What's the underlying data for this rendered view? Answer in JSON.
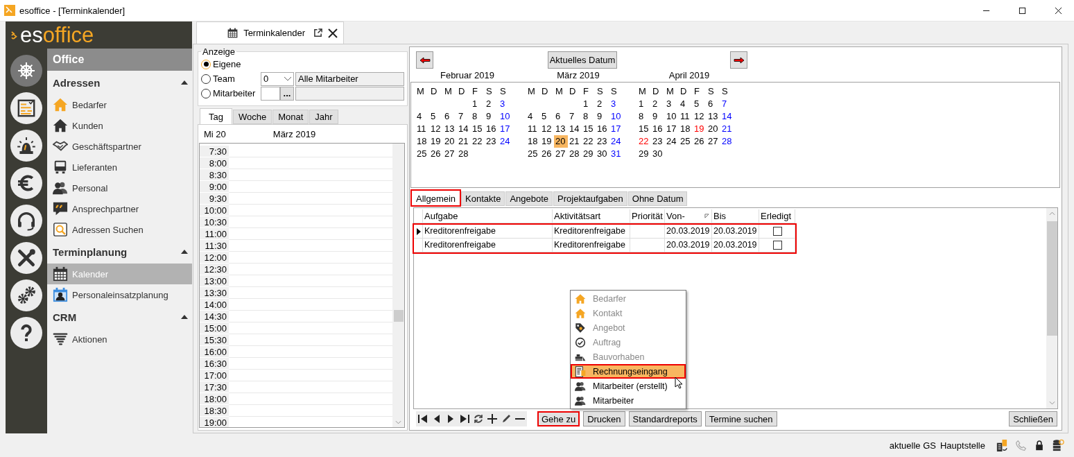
{
  "window": {
    "title": "esoffice - [Terminkalender]"
  },
  "logo": {
    "lead": "es",
    "rest": "office"
  },
  "rail": [
    {
      "selected": true
    },
    {
      "selected": false
    },
    {
      "selected": false
    },
    {
      "selected": false
    },
    {
      "selected": false
    },
    {
      "selected": false
    },
    {
      "selected": false
    },
    {
      "selected": false
    }
  ],
  "nav": {
    "header": "Office",
    "sections": [
      {
        "title": "Adressen",
        "expanded": true,
        "items": [
          {
            "label": "Bedarfer",
            "selected": false
          },
          {
            "label": "Kunden",
            "selected": false
          },
          {
            "label": "Geschäftspartner",
            "selected": false
          },
          {
            "label": "Lieferanten",
            "selected": false
          },
          {
            "label": "Personal",
            "selected": false
          },
          {
            "label": "Ansprechpartner",
            "selected": false
          },
          {
            "label": "Adressen Suchen",
            "selected": false
          }
        ]
      },
      {
        "title": "Terminplanung",
        "expanded": true,
        "items": [
          {
            "label": "Kalender",
            "selected": true
          },
          {
            "label": "Personaleinsatzplanung",
            "selected": false
          }
        ]
      },
      {
        "title": "CRM",
        "expanded": true,
        "items": [
          {
            "label": "Aktionen",
            "selected": false
          }
        ]
      }
    ]
  },
  "document_tab": {
    "title": "Terminkalender"
  },
  "display_group": {
    "title": "Anzeige",
    "options": [
      {
        "label": "Eigene",
        "selected": true
      },
      {
        "label": "Team",
        "selected": false
      },
      {
        "label": "Mitarbeiter",
        "selected": false
      }
    ],
    "team_combo": "0",
    "team_field": "Alle Mitarbeiter",
    "browse_button": "..."
  },
  "view_tabs": [
    {
      "label": "Tag",
      "selected": true
    },
    {
      "label": "Woche",
      "selected": false
    },
    {
      "label": "Monat",
      "selected": false
    },
    {
      "label": "Jahr",
      "selected": false
    }
  ],
  "day_header": {
    "day": "Mi 20",
    "month": "März 2019"
  },
  "time_slots": [
    "7:30",
    "8:00",
    "8:30",
    "9:00",
    "9:30",
    "10:00",
    "10:30",
    "11:00",
    "11:30",
    "12:00",
    "12:30",
    "13:00",
    "13:30",
    "14:00",
    "14:30",
    "15:00",
    "15:30",
    "16:00",
    "16:30",
    "17:00",
    "17:30",
    "18:00",
    "18:30",
    "19:00"
  ],
  "calendar": {
    "today_button": "Aktuelles Datum",
    "months": [
      {
        "title": "Februar 2019",
        "weekdays": [
          "M",
          "D",
          "M",
          "D",
          "F",
          "S",
          "S"
        ],
        "weeks": [
          {
            "kind": "partial_start",
            "days": [
              {
                "t": "1",
                "selected": false
              },
              {
                "t": "2",
                "selected": false
              },
              {
                "t": "3",
                "selected": false
              }
            ]
          },
          {
            "days": [
              {
                "t": "4",
                "selected": false
              },
              {
                "t": "5",
                "selected": false
              },
              {
                "t": "6",
                "selected": false
              },
              {
                "t": "7",
                "selected": false
              },
              {
                "t": "8",
                "selected": false
              },
              {
                "t": "9",
                "selected": false
              },
              {
                "t": "10",
                "selected": false
              }
            ]
          },
          {
            "days": [
              {
                "t": "11",
                "selected": false
              },
              {
                "t": "12",
                "selected": false
              },
              {
                "t": "13",
                "selected": false
              },
              {
                "t": "14",
                "selected": false
              },
              {
                "t": "15",
                "selected": false
              },
              {
                "t": "16",
                "selected": false
              },
              {
                "t": "17",
                "selected": false
              }
            ]
          },
          {
            "days": [
              {
                "t": "18",
                "selected": false
              },
              {
                "t": "19",
                "selected": false
              },
              {
                "t": "20",
                "selected": false
              },
              {
                "t": "21",
                "selected": false
              },
              {
                "t": "22",
                "selected": false
              },
              {
                "t": "23",
                "selected": false
              },
              {
                "t": "24",
                "selected": false
              }
            ]
          },
          {
            "days": [
              {
                "t": "25",
                "selected": false
              },
              {
                "t": "26",
                "selected": false
              },
              {
                "t": "27",
                "selected": false
              },
              {
                "t": "28",
                "selected": false
              }
            ]
          }
        ]
      },
      {
        "title": "März 2019",
        "weekdays": [
          "M",
          "D",
          "M",
          "D",
          "F",
          "S",
          "S"
        ],
        "weeks": [
          {
            "kind": "partial_start",
            "days": [
              {
                "t": "1",
                "selected": false
              },
              {
                "t": "2",
                "selected": false
              },
              {
                "t": "3",
                "selected": false
              }
            ]
          },
          {
            "days": [
              {
                "t": "4",
                "selected": false
              },
              {
                "t": "5",
                "selected": false
              },
              {
                "t": "6",
                "selected": false
              },
              {
                "t": "7",
                "selected": false
              },
              {
                "t": "8",
                "selected": false
              },
              {
                "t": "9",
                "selected": false
              },
              {
                "t": "10",
                "selected": false
              }
            ]
          },
          {
            "days": [
              {
                "t": "11",
                "selected": false
              },
              {
                "t": "12",
                "selected": false
              },
              {
                "t": "13",
                "selected": false
              },
              {
                "t": "14",
                "selected": false
              },
              {
                "t": "15",
                "selected": false
              },
              {
                "t": "16",
                "selected": false
              },
              {
                "t": "17",
                "selected": false
              }
            ]
          },
          {
            "days": [
              {
                "t": "18",
                "selected": false
              },
              {
                "t": "19",
                "selected": false
              },
              {
                "t": "20",
                "selected": true
              },
              {
                "t": "21",
                "selected": false
              },
              {
                "t": "22",
                "selected": false
              },
              {
                "t": "23",
                "selected": false
              },
              {
                "t": "24",
                "selected": false
              }
            ]
          },
          {
            "days": [
              {
                "t": "25",
                "selected": false
              },
              {
                "t": "26",
                "selected": false
              },
              {
                "t": "27",
                "selected": false
              },
              {
                "t": "28",
                "selected": false
              },
              {
                "t": "29",
                "selected": false
              },
              {
                "t": "30",
                "selected": false
              },
              {
                "t": "31",
                "selected": false
              }
            ]
          }
        ]
      },
      {
        "title": "April 2019",
        "weekdays": [
          "M",
          "D",
          "M",
          "D",
          "F",
          "S",
          "S"
        ],
        "weeks": [
          {
            "days": [
              {
                "t": "1",
                "selected": false
              },
              {
                "t": "2",
                "selected": false
              },
              {
                "t": "3",
                "selected": false
              },
              {
                "t": "4",
                "selected": false
              },
              {
                "t": "5",
                "selected": false
              },
              {
                "t": "6",
                "selected": false
              },
              {
                "t": "7",
                "selected": false
              }
            ]
          },
          {
            "days": [
              {
                "t": "8",
                "selected": false
              },
              {
                "t": "9",
                "selected": false
              },
              {
                "t": "10",
                "selected": false
              },
              {
                "t": "11",
                "selected": false
              },
              {
                "t": "12",
                "selected": false
              },
              {
                "t": "13",
                "selected": false
              },
              {
                "t": "14",
                "selected": false
              }
            ]
          },
          {
            "days": [
              {
                "t": "15",
                "selected": false
              },
              {
                "t": "16",
                "selected": false
              },
              {
                "t": "17",
                "selected": false
              },
              {
                "t": "18",
                "selected": false
              },
              {
                "t": "19",
                "selected": false,
                "holiday": true
              },
              {
                "t": "20",
                "selected": false
              },
              {
                "t": "21",
                "selected": false
              }
            ]
          },
          {
            "days": [
              {
                "t": "22",
                "selected": false,
                "holiday": true
              },
              {
                "t": "23",
                "selected": false
              },
              {
                "t": "24",
                "selected": false
              },
              {
                "t": "25",
                "selected": false
              },
              {
                "t": "26",
                "selected": false
              },
              {
                "t": "27",
                "selected": false
              },
              {
                "t": "28",
                "selected": false
              }
            ]
          },
          {
            "days": [
              {
                "t": "29",
                "selected": false
              },
              {
                "t": "30",
                "selected": false
              }
            ]
          }
        ]
      }
    ]
  },
  "detail_tabs": [
    {
      "label": "Allgemein",
      "selected": true,
      "highlighted": true
    },
    {
      "label": "Kontakte",
      "selected": false,
      "highlighted": false
    },
    {
      "label": "Angebote",
      "selected": false,
      "highlighted": false
    },
    {
      "label": "Projektaufgaben",
      "selected": false,
      "highlighted": false
    },
    {
      "label": "Ohne Datum",
      "selected": false,
      "highlighted": false
    }
  ],
  "table": {
    "columns": [
      {
        "label": "Aufgabe",
        "sorted": false
      },
      {
        "label": "Aktivitätsart",
        "sorted": false
      },
      {
        "label": "Priorität",
        "sorted": false
      },
      {
        "label": "Von-",
        "sorted": true
      },
      {
        "label": "Bis",
        "sorted": false
      },
      {
        "label": "Erledigt",
        "sorted": false
      }
    ],
    "rows_highlighted": true,
    "rows": [
      {
        "current": true,
        "task": "Kreditorenfreigabe",
        "activity_type": "Kreditorenfreigabe",
        "from": "20.03.2019",
        "to": "20.03.2019",
        "done": false
      },
      {
        "current": false,
        "task": "Kreditorenfreigabe",
        "activity_type": "Kreditorenfreigabe",
        "from": "20.03.2019",
        "to": "20.03.2019",
        "done": false
      }
    ]
  },
  "toolbar": {
    "buttons": [
      {
        "label": "Gehe zu",
        "highlighted": true
      },
      {
        "label": "Drucken",
        "highlighted": false
      },
      {
        "label": "Standardreports",
        "highlighted": false
      },
      {
        "label": "Termine suchen",
        "highlighted": false
      }
    ],
    "close_button": "Schließen"
  },
  "goto_menu": {
    "items": [
      {
        "label": "Bedarfer",
        "disabled": true,
        "selected": false,
        "highlighted": false
      },
      {
        "label": "Kontakt",
        "disabled": true,
        "selected": false,
        "highlighted": false
      },
      {
        "label": "Angebot",
        "disabled": true,
        "selected": false,
        "highlighted": false
      },
      {
        "label": "Auftrag",
        "disabled": true,
        "selected": false,
        "highlighted": false
      },
      {
        "label": "Bauvorhaben",
        "disabled": true,
        "selected": false,
        "highlighted": false
      },
      {
        "label": "Rechnungseingang",
        "disabled": false,
        "selected": true,
        "highlighted": true
      },
      {
        "label": "Mitarbeiter (erstellt)",
        "disabled": false,
        "selected": false,
        "highlighted": false
      },
      {
        "label": "Mitarbeiter",
        "disabled": false,
        "selected": false,
        "highlighted": false
      }
    ]
  },
  "status_bar": {
    "branch_label": "aktuelle GS",
    "branch": "Hauptstelle"
  }
}
